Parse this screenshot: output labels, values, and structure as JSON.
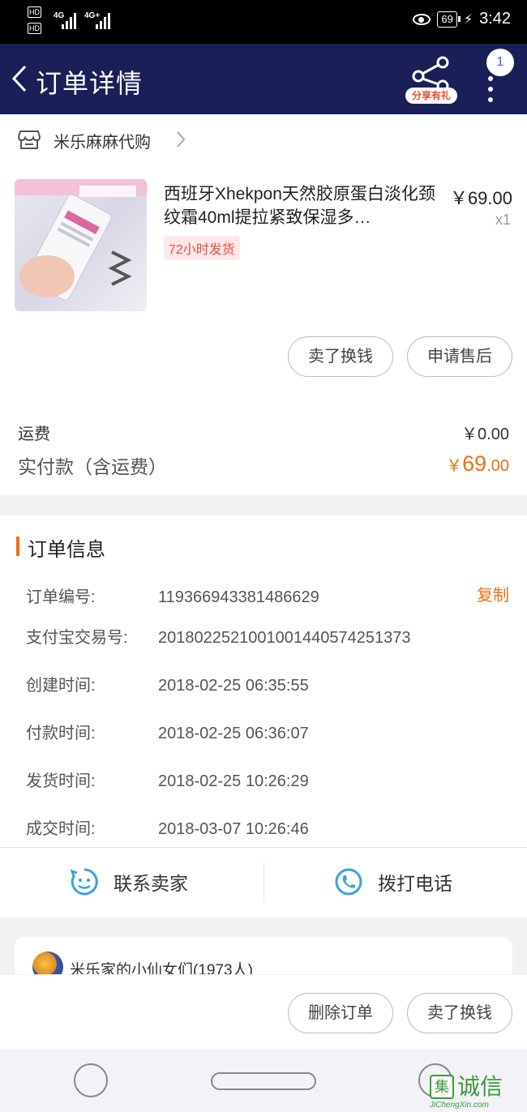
{
  "status_bar": {
    "hd1": "HD",
    "hd2": "HD",
    "net1": "4G",
    "net2": "4G+",
    "battery": "69",
    "time": "3:42"
  },
  "navbar": {
    "title": "订单详情",
    "share_label": "分享有礼",
    "badge_count": "1"
  },
  "shop": {
    "name": "米乐麻麻代购"
  },
  "product": {
    "title": "西班牙Xhekpon天然胶原蛋白淡化颈纹霜40ml提拉紧致保湿多…",
    "tag": "72小时发货",
    "price": "￥69.00",
    "quantity": "x1",
    "buttons": [
      "卖了换钱",
      "申请售后"
    ]
  },
  "summary": {
    "shipping_label": "运费",
    "shipping_value": "￥0.00",
    "paid_label": "实付款（含运费）",
    "paid_symbol": "￥",
    "paid_integer": "69",
    "paid_decimal": ".00"
  },
  "order_info": {
    "title": "订单信息",
    "copy_label": "复制",
    "rows": [
      {
        "key": "订单编号:",
        "value": "119366943381486629"
      },
      {
        "key": "支付宝交易号:",
        "value": "2018022521001001440574251373"
      },
      {
        "key": "创建时间:",
        "value": "2018-02-25 06:35:55"
      },
      {
        "key": "付款时间:",
        "value": "2018-02-25 06:36:07"
      },
      {
        "key": "发货时间:",
        "value": "2018-02-25 10:26:29"
      },
      {
        "key": "成交时间:",
        "value": "2018-03-07 10:26:46"
      }
    ]
  },
  "actions": {
    "contact_seller": "联系卖家",
    "call_phone": "拨打电话"
  },
  "group": {
    "name": "米乐家的小仙女们(1973人)"
  },
  "bottom_actions": [
    "删除订单",
    "卖了换钱"
  ],
  "watermark": {
    "logo_char": "集",
    "text": "诚信",
    "url": "JiChengXin.com"
  },
  "colors": {
    "navbar_bg": "#1a2057",
    "accent_orange": "#f06e12",
    "icon_blue": "#3aa0e0"
  }
}
